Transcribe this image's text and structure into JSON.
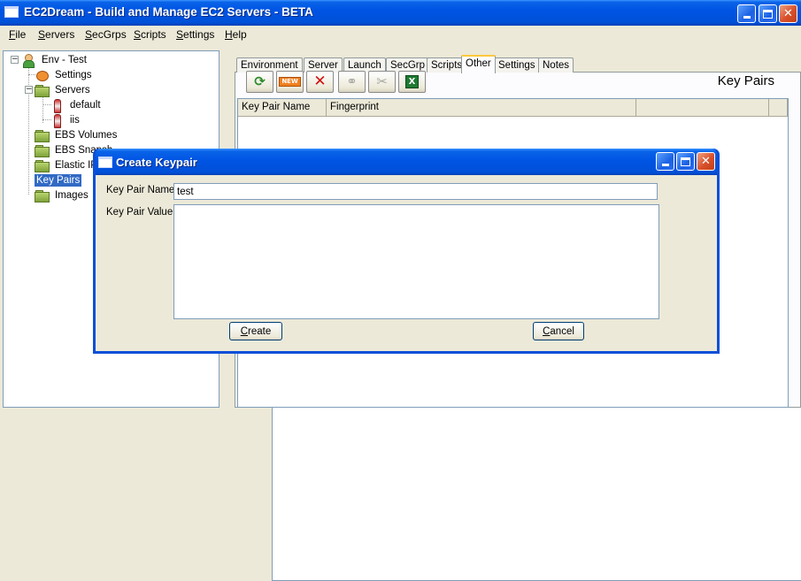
{
  "window": {
    "title": "EC2Dream - Build and Manage EC2 Servers - BETA",
    "controls": {
      "minimize": "_",
      "maximize": "□",
      "close": "✕"
    }
  },
  "menu": [
    {
      "label": "File",
      "hotkey": "F",
      "rest": "ile"
    },
    {
      "label": "Servers",
      "hotkey": "S",
      "rest": "ervers"
    },
    {
      "label": "SecGrps",
      "hotkey": "S",
      "rest": "ecGrps"
    },
    {
      "label": "Scripts",
      "hotkey": "S",
      "rest": "cripts"
    },
    {
      "label": "Settings",
      "hotkey": "S",
      "rest": "ettings"
    },
    {
      "label": "Help",
      "hotkey": "H",
      "rest": "elp"
    }
  ],
  "tree": {
    "env": "Env - Test",
    "settings": "Settings",
    "servers": "Servers",
    "server_default": "default",
    "server_iis": "iis",
    "ebs_volumes": "EBS Volumes",
    "ebs_snapshots": "EBS Snapsh",
    "elastic_ips": "Elastic IPs",
    "key_pairs": "Key Pairs",
    "images": "Images",
    "expander_minus": "−"
  },
  "tabs": [
    "Environment",
    "Server",
    "Launch",
    "SecGrp",
    "Scripts",
    "Other",
    "Settings",
    "Notes"
  ],
  "active_tab": "Other",
  "toolbar": {
    "icons": [
      "refresh-icon",
      "new-icon",
      "delete-icon",
      "link-icon",
      "tools-icon",
      "excel-icon"
    ],
    "new_label": "NEW",
    "delete_glyph": "✕",
    "refresh_glyph": "⟳",
    "link_glyph": "⚭",
    "tools_glyph": "✂",
    "excel_glyph": "X"
  },
  "panel_title": "Key Pairs",
  "grid": {
    "columns": [
      "Key Pair Name",
      "Fingerprint",
      "",
      ""
    ]
  },
  "dialog": {
    "title": "Create Keypair",
    "name_label": "Key Pair Name",
    "name_value": "test",
    "value_label": "Key Pair Value",
    "value_value": "",
    "create_label": "Create",
    "create_hotkey": "C",
    "create_rest": "reate",
    "cancel_label": "Cancel",
    "cancel_hotkey": "C",
    "cancel_rest": "ancel"
  },
  "colors": {
    "titlebar": "#0054e3",
    "selection": "#316ac5",
    "close_button": "#d8502a",
    "tab_highlight": "#ffc83c"
  }
}
